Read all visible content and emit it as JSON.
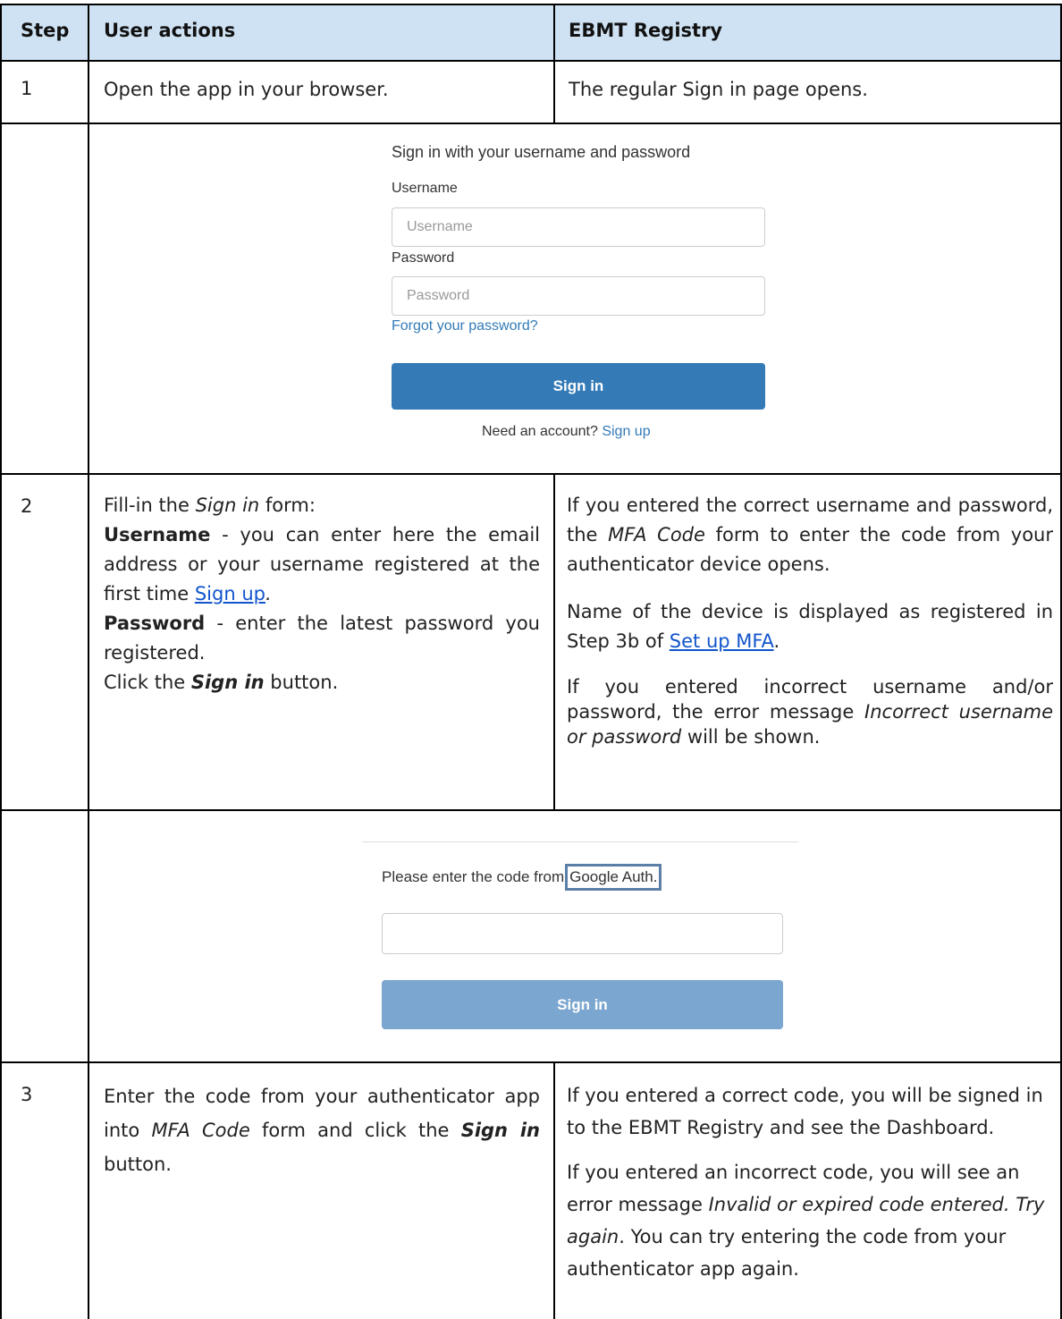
{
  "table": {
    "headers": {
      "step": "Step",
      "user_actions": "User actions",
      "registry": "EBMT Registry"
    },
    "row1": {
      "step": "1",
      "user_action": "Open the app in your browser.",
      "registry_response": "The regular Sign in page opens."
    },
    "row2": {
      "step": "2",
      "ua_line1_pre": "Fill-in the ",
      "ua_line1_em": "Sign in",
      "ua_line1_post": " form:",
      "ua_username_label": "Username",
      "ua_username_text": " - you can enter here the email address or your username registered at the first time ",
      "ua_signup_link": "Sign up",
      "ua_signup_after": ".",
      "ua_password_label": "Password",
      "ua_password_text": " - enter the latest password you registered.",
      "ua_click_pre": "Click the ",
      "ua_click_em": "Sign in",
      "ua_click_post": " button.",
      "reg_p1_pre": "If you entered the correct username and password, the ",
      "reg_p1_em": "MFA Code",
      "reg_p1_post": " form to enter the code from your authenticator device opens.",
      "reg_p2_pre": "Name of the device is displayed as registered in Step 3b of ",
      "reg_p2_link": "Set up MFA",
      "reg_p2_post": ".",
      "reg_p3_pre": "If you entered incorrect username and/or password, the error message ",
      "reg_p3_em": "Incorrect username or password",
      "reg_p3_post": " will be shown."
    },
    "row3": {
      "step": "3",
      "ua_pre": "Enter the code from your authenticator app into ",
      "ua_em": "MFA Code",
      "ua_mid": " form and click the ",
      "ua_bi": "Sign in",
      "ua_post": " button.",
      "reg_p1": "If you entered a correct code, you will be signed in to the EBMT Registry and see the Dashboard.",
      "reg_p2_pre": "If you entered an incorrect code, you will see an error message ",
      "reg_p2_em": "Invalid or expired code entered. Try again",
      "reg_p2_post": ". You can try entering the code from your authenticator app again."
    }
  },
  "signin_screenshot": {
    "title": "Sign in with your username and password",
    "username_label": "Username",
    "username_placeholder": "Username",
    "password_label": "Password",
    "password_placeholder": "Password",
    "forgot_link": "Forgot your password?",
    "button": "Sign in",
    "need_account": "Need an account?",
    "signup_link": "Sign up"
  },
  "mfa_screenshot": {
    "prompt": "Please enter the code from",
    "device_name": "Google Auth.",
    "button": "Sign in"
  },
  "colors": {
    "header_bg": "#cfe2f3",
    "link": "#1155cc",
    "primary_button": "#337ab7",
    "disabled_button": "#7ba6cf",
    "highlight_border": "#5b7fa6"
  }
}
